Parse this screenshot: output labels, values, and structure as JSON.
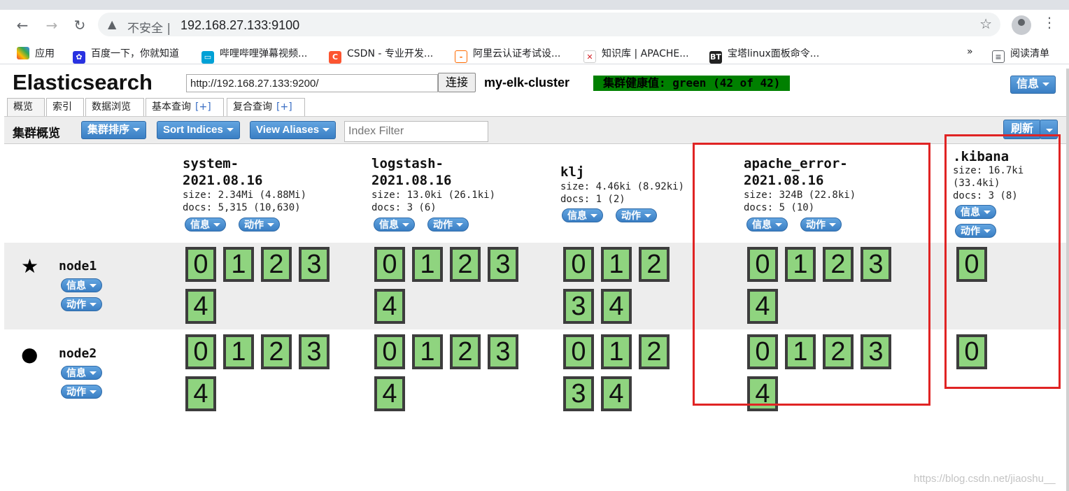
{
  "browser": {
    "security_label": "不安全",
    "url": "192.168.27.133:9100",
    "bookmarks": [
      "应用",
      "百度一下，你就知道",
      "哔哩哔哩弹幕视频...",
      "CSDN - 专业开发...",
      "阿里云认证考试设...",
      "知识库 | APACHE...",
      "宝塔linux面板命令..."
    ],
    "overflow": "»",
    "reading_list": "阅读清单"
  },
  "header": {
    "brand": "Elasticsearch",
    "connect_url": "http://192.168.27.133:9200/",
    "connect_label": "连接",
    "cluster_name": "my-elk-cluster",
    "health": "集群健康值: green (42 of 42)",
    "info_label": "信息"
  },
  "tabs": [
    {
      "label": "概览",
      "plus": ""
    },
    {
      "label": "索引",
      "plus": ""
    },
    {
      "label": "数据浏览",
      "plus": ""
    },
    {
      "label": "基本查询",
      "plus": "[+]"
    },
    {
      "label": "复合查询",
      "plus": "[+]"
    }
  ],
  "toolbar": {
    "title": "集群概览",
    "sort_cluster": "集群排序",
    "sort_indices": "Sort Indices",
    "view_aliases": "View Aliases",
    "filter_placeholder": "Index Filter",
    "refresh": "刷新"
  },
  "indices": [
    {
      "name": "system-\n2021.08.16",
      "size": "size: 2.34Mi (4.88Mi)",
      "docs": "docs: 5,315 (10,630)",
      "info": "信息",
      "action": "动作"
    },
    {
      "name": "logstash-\n2021.08.16",
      "size": "size: 13.0ki (26.1ki)",
      "docs": "docs: 3 (6)",
      "info": "信息",
      "action": "动作"
    },
    {
      "name": "klj",
      "size": "size: 4.46ki (8.92ki)",
      "docs": "docs: 1 (2)",
      "info": "信息",
      "action": "动作"
    },
    {
      "name": "apache_error-\n2021.08.16",
      "size": "size: 324B (22.8ki)",
      "docs": "docs: 5 (10)",
      "info": "信息",
      "action": "动作"
    },
    {
      "name": ".kibana",
      "size": "size: 16.7ki\n(33.4ki)",
      "docs": "docs: 3 (8)",
      "info": "信息",
      "action": "动作"
    }
  ],
  "nodes": [
    {
      "name": "node1",
      "icon": "star-icon",
      "info": "信息",
      "action": "动作"
    },
    {
      "name": "node2",
      "icon": "circle-icon",
      "info": "信息",
      "action": "动作"
    }
  ],
  "shards": {
    "node1": [
      [
        "0",
        "1",
        "2",
        "3",
        "4"
      ],
      [
        "0",
        "1",
        "2",
        "3",
        "4"
      ],
      [
        "0",
        "1",
        "2",
        "3",
        "4"
      ],
      [
        "0",
        "1",
        "2",
        "3",
        "4"
      ],
      [
        "0"
      ]
    ],
    "node2": [
      [
        "0",
        "1",
        "2",
        "3",
        "4"
      ],
      [
        "0",
        "1",
        "2",
        "3",
        "4"
      ],
      [
        "0",
        "1",
        "2",
        "3",
        "4"
      ],
      [
        "0",
        "1",
        "2",
        "3",
        "4"
      ],
      [
        "0"
      ]
    ]
  },
  "colors": {
    "health": "#008000",
    "shard": "#8fd47f",
    "highlight": "#e02424",
    "button": "#3a7fc4"
  },
  "watermark": "https://blog.csdn.net/jiaoshu__"
}
